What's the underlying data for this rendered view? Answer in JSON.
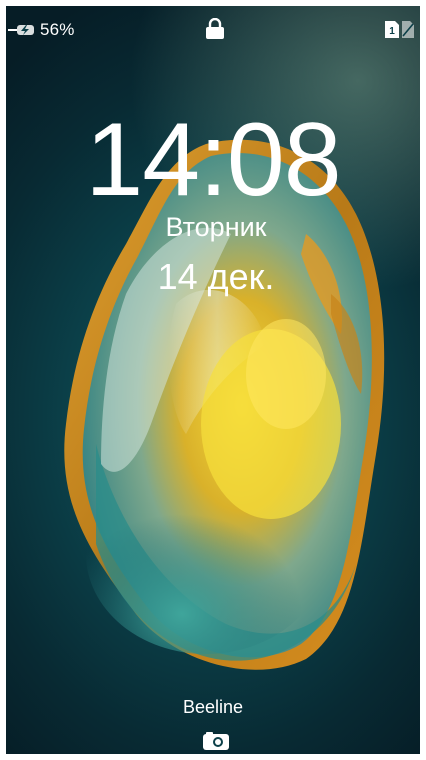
{
  "status_bar": {
    "battery_percent": "56%",
    "battery_level": 0.56,
    "charging": true,
    "icons": [
      "charging-battery-icon",
      "lock-icon",
      "sim1-icon",
      "sim2-icon"
    ]
  },
  "lockscreen": {
    "time": "14:08",
    "weekday": "Вторник",
    "date": "14 дек.",
    "carrier": "Beeline"
  },
  "colors": {
    "text": "#ffffff",
    "background_teal": "#0b3f48",
    "gem_amber": "#e8a21a",
    "gem_yellow": "#f3d23a"
  },
  "shortcuts": {
    "bottom_icon": "camera-icon"
  }
}
